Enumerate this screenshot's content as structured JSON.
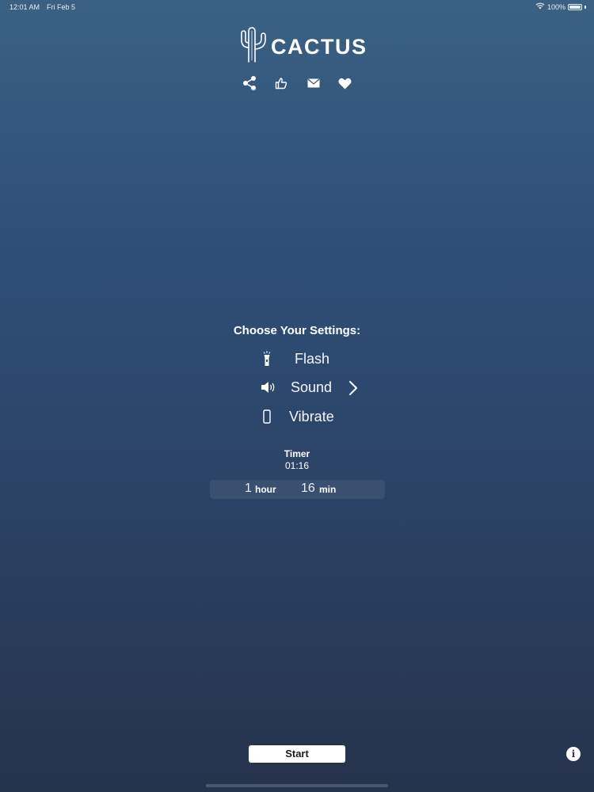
{
  "status_bar": {
    "time": "12:01 AM",
    "date": "Fri Feb 5",
    "battery": "100%"
  },
  "app": {
    "name": "CACTUS"
  },
  "social": {
    "icons": [
      "share-icon",
      "thumbs-up-icon",
      "mail-icon",
      "heart-icon"
    ]
  },
  "settings": {
    "title": "Choose Your Settings:",
    "options": [
      {
        "label": "Flash",
        "icon": "flashlight-icon"
      },
      {
        "label": "Sound",
        "icon": "speaker-icon"
      },
      {
        "label": "Vibrate",
        "icon": "phone-icon"
      }
    ]
  },
  "timer": {
    "title": "Timer",
    "value": "01:16",
    "hours": "1",
    "hours_unit": "hour",
    "minutes": "16",
    "minutes_unit": "min"
  },
  "actions": {
    "start_label": "Start",
    "info_label": "i"
  },
  "colors": {
    "background_top": "#3a6183",
    "background_bottom": "#25334d",
    "button": "#ffffff"
  }
}
